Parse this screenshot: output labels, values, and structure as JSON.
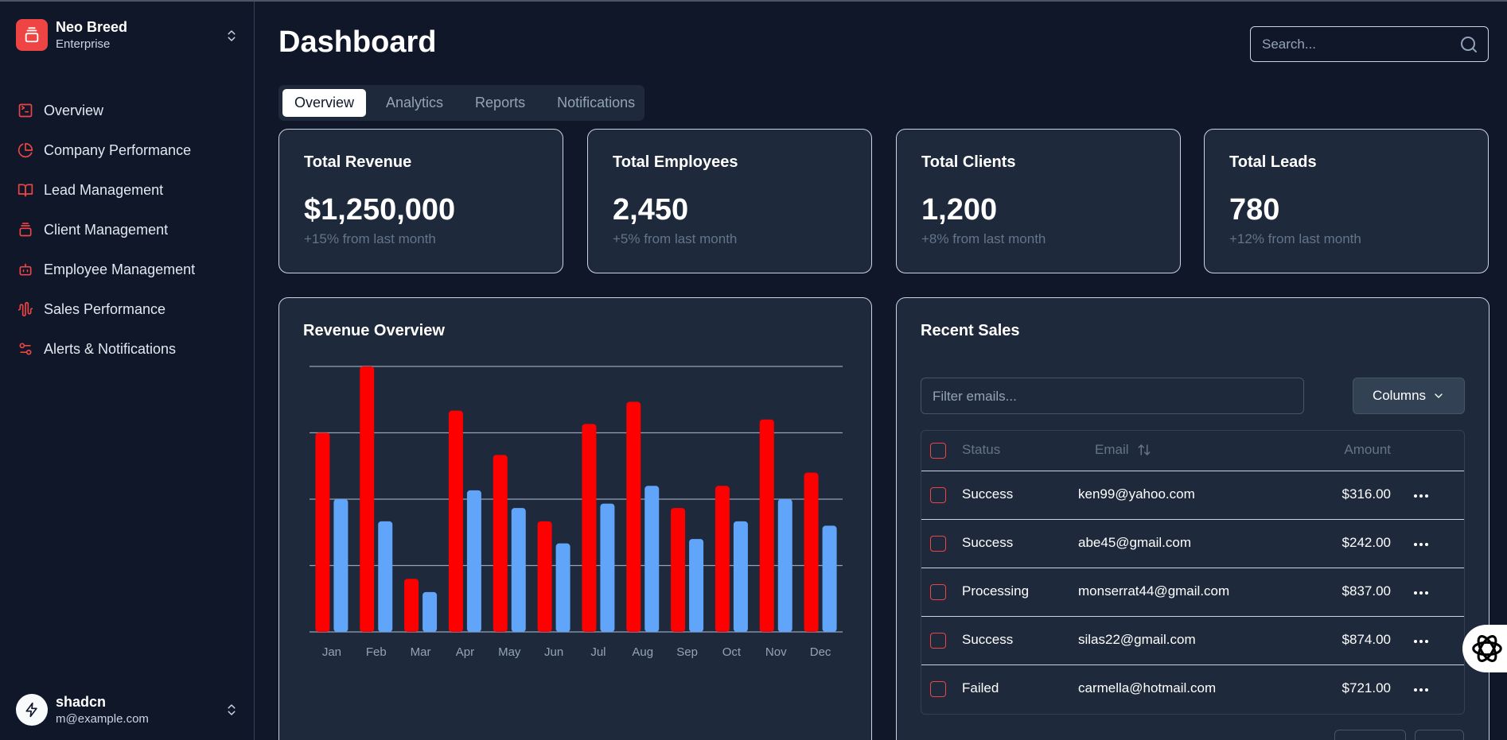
{
  "brand": {
    "name": "Neo Breed",
    "plan": "Enterprise"
  },
  "nav": [
    {
      "label": "Overview",
      "icon": "square-terminal-icon"
    },
    {
      "label": "Company Performance",
      "icon": "pie-chart-icon"
    },
    {
      "label": "Lead Management",
      "icon": "book-open-icon"
    },
    {
      "label": "Client Management",
      "icon": "layers-icon"
    },
    {
      "label": "Employee Management",
      "icon": "bot-icon"
    },
    {
      "label": "Sales Performance",
      "icon": "audio-waveform-icon"
    },
    {
      "label": "Alerts & Notifications",
      "icon": "settings-sliders-icon"
    }
  ],
  "user": {
    "name": "shadcn",
    "email": "m@example.com"
  },
  "page": {
    "title": "Dashboard"
  },
  "search": {
    "placeholder": "Search..."
  },
  "tabs": [
    {
      "label": "Overview",
      "active": true
    },
    {
      "label": "Analytics",
      "active": false
    },
    {
      "label": "Reports",
      "active": false
    },
    {
      "label": "Notifications",
      "active": false
    }
  ],
  "stats": [
    {
      "title": "Total Revenue",
      "value": "$1,250,000",
      "sub": "+15% from last month"
    },
    {
      "title": "Total Employees",
      "value": "2,450",
      "sub": "+5% from last month"
    },
    {
      "title": "Total Clients",
      "value": "1,200",
      "sub": "+8% from last month"
    },
    {
      "title": "Total Leads",
      "value": "780",
      "sub": "+12% from last month"
    }
  ],
  "revenue": {
    "title": "Revenue Overview"
  },
  "chart_data": {
    "type": "bar",
    "categories": [
      "Jan",
      "Feb",
      "Mar",
      "Apr",
      "May",
      "Jun",
      "Jul",
      "Aug",
      "Sep",
      "Oct",
      "Nov",
      "Dec"
    ],
    "series": [
      {
        "values": [
          450,
          600,
          120,
          500,
          400,
          250,
          470,
          520,
          280,
          330,
          480,
          360
        ],
        "color": "#ff0000"
      },
      {
        "values": [
          300,
          250,
          90,
          320,
          280,
          200,
          290,
          330,
          210,
          250,
          300,
          240
        ],
        "color": "#60a5fa"
      }
    ],
    "ylim": [
      0,
      600
    ],
    "grid": true,
    "gridlines": 5
  },
  "sales": {
    "title": "Recent Sales",
    "filter_placeholder": "Filter emails...",
    "columns_label": "Columns",
    "headers": {
      "status": "Status",
      "email": "Email",
      "amount": "Amount"
    },
    "rows": [
      {
        "status": "Success",
        "email": "ken99@yahoo.com",
        "amount": "$316.00"
      },
      {
        "status": "Success",
        "email": "abe45@gmail.com",
        "amount": "$242.00"
      },
      {
        "status": "Processing",
        "email": "monserrat44@gmail.com",
        "amount": "$837.00"
      },
      {
        "status": "Success",
        "email": "silas22@gmail.com",
        "amount": "$874.00"
      },
      {
        "status": "Failed",
        "email": "carmella@hotmail.com",
        "amount": "$721.00"
      }
    ]
  },
  "colors": {
    "accent": "#ef4444",
    "background": "#0f1729",
    "card": "#1e293b",
    "bar_primary": "#ff0000",
    "bar_secondary": "#60a5fa"
  }
}
